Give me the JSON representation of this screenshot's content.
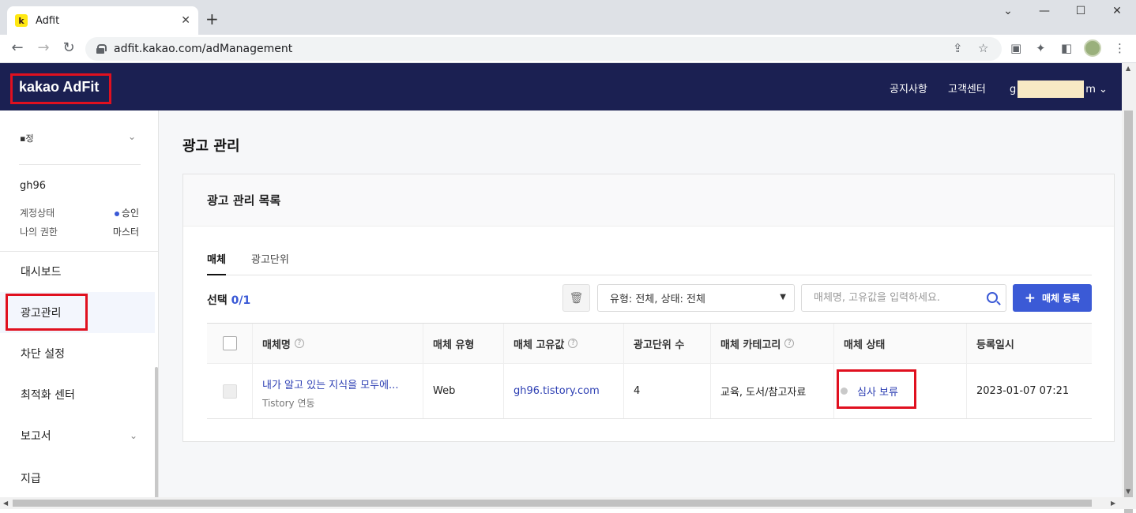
{
  "browser": {
    "tab_title": "Adfit",
    "favicon_letter": "k",
    "close_tab": "✕",
    "new_tab": "+",
    "url": "adfit.kakao.com/adManagement",
    "win_min": "⌄",
    "win_min2": "—",
    "win_max": "☐",
    "win_close": "✕"
  },
  "header": {
    "logo": "kakao AdFit",
    "notice": "공지사항",
    "support": "고객센터",
    "account_prefix": "g",
    "account_suffix": "m",
    "account_caret": "⌄"
  },
  "sidebar": {
    "site_name": "▪정",
    "user": "gh96",
    "status_label": "계정상태",
    "status_value": "승인",
    "role_label": "나의 권한",
    "role_value": "마스터",
    "items": [
      {
        "label": "대시보드"
      },
      {
        "label": "광고관리"
      },
      {
        "label": "차단 설정"
      },
      {
        "label": "최적화 센터"
      },
      {
        "label": "보고서"
      },
      {
        "label": "지급"
      }
    ]
  },
  "main": {
    "page_title": "광고 관리",
    "card_title": "광고 관리 목록",
    "tabs": [
      {
        "label": "매체"
      },
      {
        "label": "광고단위"
      }
    ],
    "selection_label": "선택",
    "selection_count": "0/1",
    "filter_value": "유형: 전체, 상태: 전체",
    "search_placeholder": "매체명, 고유값을 입력하세요.",
    "add_button": "매체 등록",
    "table": {
      "columns": [
        "매체명",
        "매체 유형",
        "매체 고유값",
        "광고단위 수",
        "매체 카테고리",
        "매체 상태",
        "등록일시"
      ],
      "help_mark": "?",
      "rows": [
        {
          "name": "내가 알고 있는 지식을 모두에...",
          "sub": "Tistory 연동",
          "type": "Web",
          "unique": "gh96.tistory.com",
          "unit_count": "4",
          "category": "교육, 도서/참고자료",
          "status": "심사 보류",
          "registered": "2023-01-07 07:21"
        }
      ]
    }
  },
  "colors": {
    "header_bg": "#1b2052",
    "accent": "#3b5ad6",
    "highlight": "#e0101f"
  }
}
